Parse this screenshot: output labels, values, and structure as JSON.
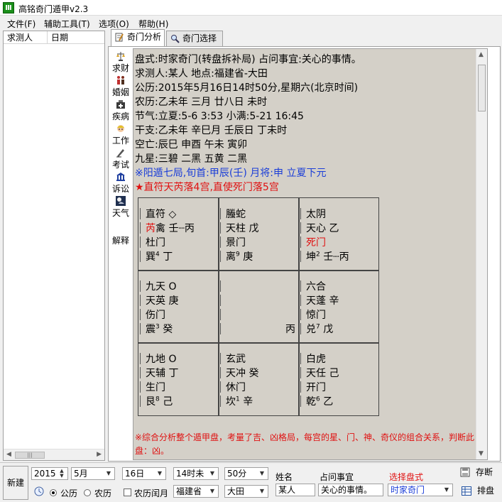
{
  "app": {
    "title": "高铭奇门遁甲v2.3",
    "icon_glyph": "Ⅲ"
  },
  "menu": [
    "文件(F)",
    "辅助工具(T)",
    "选项(O)",
    "帮助(H)"
  ],
  "left_list": {
    "columns": [
      "求测人",
      "日期"
    ]
  },
  "tabs": [
    {
      "label": "奇门分析",
      "icon": "pen-icon",
      "active": true
    },
    {
      "label": "奇门选择",
      "icon": "magnifier-icon",
      "active": false
    }
  ],
  "categories": [
    {
      "label": "求财",
      "icon": "scale-icon"
    },
    {
      "label": "婚姻",
      "icon": "couple-icon"
    },
    {
      "label": "疾病",
      "icon": "medicine-icon"
    },
    {
      "label": "工作",
      "icon": "worker-icon"
    },
    {
      "label": "考试",
      "icon": "exam-icon"
    },
    {
      "label": "诉讼",
      "icon": "court-icon"
    },
    {
      "label": "天气",
      "icon": "weather-icon"
    },
    {
      "label": "解释",
      "icon": ""
    }
  ],
  "info_lines": [
    "盘式:时家奇门(转盘拆补局)  占问事宜:关心的事情。",
    "求测人:某人  地点:福建省-大田",
    "公历:2015年5月16日14时50分,星期六(北京时间)",
    "农历:乙未年 三月 廿八日 未时",
    "节气:立夏:5-6 3:53  小满:5-21 16:45",
    "干支:乙未年 辛巳月 壬辰日 丁未时",
    "空亡:辰巳   申酉   午未   寅卯",
    "九星:三碧   二黑   五黄   二黑"
  ],
  "highlight_blue": "※阳遁七局,旬首:甲辰(壬)  月将:申  立夏下元",
  "highlight_red": "★直符天芮落4宫,直使死门落5宫",
  "palaces": [
    {
      "l1a": "直符",
      "l1b": "◇",
      "l2a": "芮",
      "l2b": "禽  壬┈丙",
      "l3": "杜门",
      "l4": "巽",
      "l4n": "4",
      "l4b": "丁",
      "red2": true,
      "red3": false
    },
    {
      "l1a": "螣蛇",
      "l1b": "",
      "l2a": "",
      "l2b": "天柱  戊",
      "l3": "景门",
      "l4": "离",
      "l4n": "9",
      "l4b": "庚",
      "red2": false,
      "red3": false
    },
    {
      "l1a": "太阴",
      "l1b": "",
      "l2a": "",
      "l2b": "天心  乙",
      "l3": "死门",
      "l4": "坤",
      "l4n": "2",
      "l4b": "壬┈丙",
      "red2": false,
      "red3": true
    },
    {
      "l1a": "九天",
      "l1b": "O",
      "l2a": "",
      "l2b": "天英  庚",
      "l3": "伤门",
      "l4": "震",
      "l4n": "3",
      "l4b": "癸",
      "red2": false,
      "red3": false
    },
    {
      "l1a": "",
      "l1b": "",
      "l2a": "",
      "l2b": "",
      "l3": "",
      "l4": "",
      "l4n": "",
      "l4b": "丙",
      "red2": false,
      "red3": false
    },
    {
      "l1a": "六合",
      "l1b": "",
      "l2a": "",
      "l2b": "天蓬  辛",
      "l3": "惊门",
      "l4": "兑",
      "l4n": "7",
      "l4b": "戊",
      "red2": false,
      "red3": false
    },
    {
      "l1a": "九地",
      "l1b": "O",
      "l2a": "",
      "l2b": "天辅  丁",
      "l3": "生门",
      "l4": "艮",
      "l4n": "8",
      "l4b": "己",
      "red2": false,
      "red3": false
    },
    {
      "l1a": "玄武",
      "l1b": "",
      "l2a": "",
      "l2b": "天冲  癸",
      "l3": "休门",
      "l4": "坎",
      "l4n": "1",
      "l4b": "辛",
      "red2": false,
      "red3": false
    },
    {
      "l1a": "白虎",
      "l1b": "",
      "l2a": "",
      "l2b": "天任  己",
      "l3": "开门",
      "l4": "乾",
      "l4n": "6",
      "l4b": "乙",
      "red2": false,
      "red3": false
    }
  ],
  "footer_note": "※综合分析整个遁甲盘，考量了吉、凶格局，每宫的星、门、神、奇仪的组合关系，判断此盘：凶。",
  "toolbar": {
    "new_label": "新建",
    "year": "2015",
    "month": "5月",
    "day": "16日",
    "hour": "14时未",
    "minute": "50分",
    "gregorian_label": "公历",
    "lunar_label": "农历",
    "leap_label": "农历闰月",
    "province": "福建省",
    "city": "大田",
    "name_label": "姓名",
    "name_value": "某人",
    "matter_label": "占问事宜",
    "matter_value": "关心的事情。",
    "chart_type_label": "选择盘式",
    "chart_type_value": "时家奇门",
    "save_label": "存断",
    "arrange_label": "排盘",
    "accent_red": "#e01010"
  }
}
